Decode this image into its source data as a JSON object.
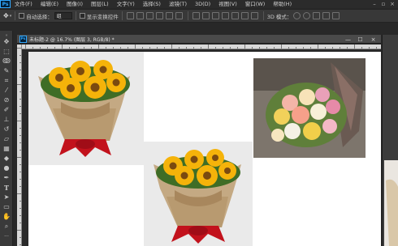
{
  "app": {
    "logo_text": "Ps"
  },
  "menu": {
    "items": [
      "文件(F)",
      "编辑(E)",
      "图像(I)",
      "图层(L)",
      "文字(Y)",
      "选择(S)",
      "滤镜(T)",
      "3D(D)",
      "视图(V)",
      "窗口(W)",
      "帮助(H)"
    ]
  },
  "options": {
    "auto_select_label": "自动选择：",
    "auto_select_value": "组",
    "transform_label": "显示变换控件",
    "mode_3d_label": "3D 模式："
  },
  "document": {
    "tab_title": "未标题-2 @ 16.7% (图层 3, RGB/8) *",
    "close_label": "×",
    "minimize_label": "—",
    "restore_label": "☐"
  },
  "colors": {
    "ps_blue": "#31a8ff",
    "chrome_dark": "#282828",
    "canvas_white": "#ffffff"
  },
  "images": [
    {
      "name": "sunflower-bouquet-1",
      "description_icon": "sunflower-bouquet"
    },
    {
      "name": "sunflower-bouquet-2",
      "description_icon": "sunflower-bouquet"
    },
    {
      "name": "rose-bouquet",
      "description_icon": "rose-bouquet"
    }
  ]
}
